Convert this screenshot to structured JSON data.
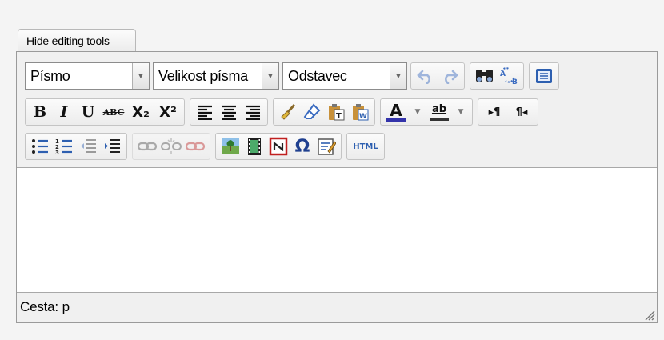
{
  "tab": {
    "label": "Hide editing tools"
  },
  "toolbar": {
    "font_select": "Písmo",
    "size_select": "Velikost písma",
    "format_select": "Odstavec",
    "bold_label": "B",
    "italic_label": "I",
    "underline_label": "U",
    "strike_label": "ABC",
    "subscript_label": "X₂",
    "superscript_label": "X²",
    "text_color_label": "A",
    "highlight_label": "ab",
    "ltr_label": "▸¶",
    "rtl_label": "¶◂",
    "omega_label": "Ω",
    "html_label": "HTML"
  },
  "statusbar": {
    "path_label": "Cesta:",
    "path_value": "p"
  },
  "colors": {
    "text_color_bar": "#3333aa",
    "highlight_bar": "#333333",
    "accent_blue": "#2d5fb0"
  }
}
